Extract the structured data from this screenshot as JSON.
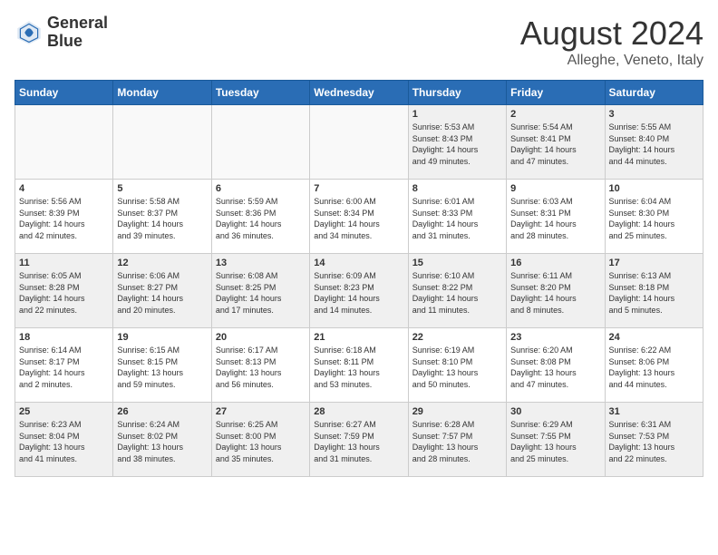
{
  "header": {
    "logo_line1": "General",
    "logo_line2": "Blue",
    "month_year": "August 2024",
    "location": "Alleghe, Veneto, Italy"
  },
  "days_of_week": [
    "Sunday",
    "Monday",
    "Tuesday",
    "Wednesday",
    "Thursday",
    "Friday",
    "Saturday"
  ],
  "weeks": [
    [
      {
        "day": "",
        "info": "",
        "empty": true
      },
      {
        "day": "",
        "info": "",
        "empty": true
      },
      {
        "day": "",
        "info": "",
        "empty": true
      },
      {
        "day": "",
        "info": "",
        "empty": true
      },
      {
        "day": "1",
        "info": "Sunrise: 5:53 AM\nSunset: 8:43 PM\nDaylight: 14 hours\nand 49 minutes.",
        "empty": false
      },
      {
        "day": "2",
        "info": "Sunrise: 5:54 AM\nSunset: 8:41 PM\nDaylight: 14 hours\nand 47 minutes.",
        "empty": false
      },
      {
        "day": "3",
        "info": "Sunrise: 5:55 AM\nSunset: 8:40 PM\nDaylight: 14 hours\nand 44 minutes.",
        "empty": false
      }
    ],
    [
      {
        "day": "4",
        "info": "Sunrise: 5:56 AM\nSunset: 8:39 PM\nDaylight: 14 hours\nand 42 minutes.",
        "empty": false
      },
      {
        "day": "5",
        "info": "Sunrise: 5:58 AM\nSunset: 8:37 PM\nDaylight: 14 hours\nand 39 minutes.",
        "empty": false
      },
      {
        "day": "6",
        "info": "Sunrise: 5:59 AM\nSunset: 8:36 PM\nDaylight: 14 hours\nand 36 minutes.",
        "empty": false
      },
      {
        "day": "7",
        "info": "Sunrise: 6:00 AM\nSunset: 8:34 PM\nDaylight: 14 hours\nand 34 minutes.",
        "empty": false
      },
      {
        "day": "8",
        "info": "Sunrise: 6:01 AM\nSunset: 8:33 PM\nDaylight: 14 hours\nand 31 minutes.",
        "empty": false
      },
      {
        "day": "9",
        "info": "Sunrise: 6:03 AM\nSunset: 8:31 PM\nDaylight: 14 hours\nand 28 minutes.",
        "empty": false
      },
      {
        "day": "10",
        "info": "Sunrise: 6:04 AM\nSunset: 8:30 PM\nDaylight: 14 hours\nand 25 minutes.",
        "empty": false
      }
    ],
    [
      {
        "day": "11",
        "info": "Sunrise: 6:05 AM\nSunset: 8:28 PM\nDaylight: 14 hours\nand 22 minutes.",
        "empty": false
      },
      {
        "day": "12",
        "info": "Sunrise: 6:06 AM\nSunset: 8:27 PM\nDaylight: 14 hours\nand 20 minutes.",
        "empty": false
      },
      {
        "day": "13",
        "info": "Sunrise: 6:08 AM\nSunset: 8:25 PM\nDaylight: 14 hours\nand 17 minutes.",
        "empty": false
      },
      {
        "day": "14",
        "info": "Sunrise: 6:09 AM\nSunset: 8:23 PM\nDaylight: 14 hours\nand 14 minutes.",
        "empty": false
      },
      {
        "day": "15",
        "info": "Sunrise: 6:10 AM\nSunset: 8:22 PM\nDaylight: 14 hours\nand 11 minutes.",
        "empty": false
      },
      {
        "day": "16",
        "info": "Sunrise: 6:11 AM\nSunset: 8:20 PM\nDaylight: 14 hours\nand 8 minutes.",
        "empty": false
      },
      {
        "day": "17",
        "info": "Sunrise: 6:13 AM\nSunset: 8:18 PM\nDaylight: 14 hours\nand 5 minutes.",
        "empty": false
      }
    ],
    [
      {
        "day": "18",
        "info": "Sunrise: 6:14 AM\nSunset: 8:17 PM\nDaylight: 14 hours\nand 2 minutes.",
        "empty": false
      },
      {
        "day": "19",
        "info": "Sunrise: 6:15 AM\nSunset: 8:15 PM\nDaylight: 13 hours\nand 59 minutes.",
        "empty": false
      },
      {
        "day": "20",
        "info": "Sunrise: 6:17 AM\nSunset: 8:13 PM\nDaylight: 13 hours\nand 56 minutes.",
        "empty": false
      },
      {
        "day": "21",
        "info": "Sunrise: 6:18 AM\nSunset: 8:11 PM\nDaylight: 13 hours\nand 53 minutes.",
        "empty": false
      },
      {
        "day": "22",
        "info": "Sunrise: 6:19 AM\nSunset: 8:10 PM\nDaylight: 13 hours\nand 50 minutes.",
        "empty": false
      },
      {
        "day": "23",
        "info": "Sunrise: 6:20 AM\nSunset: 8:08 PM\nDaylight: 13 hours\nand 47 minutes.",
        "empty": false
      },
      {
        "day": "24",
        "info": "Sunrise: 6:22 AM\nSunset: 8:06 PM\nDaylight: 13 hours\nand 44 minutes.",
        "empty": false
      }
    ],
    [
      {
        "day": "25",
        "info": "Sunrise: 6:23 AM\nSunset: 8:04 PM\nDaylight: 13 hours\nand 41 minutes.",
        "empty": false
      },
      {
        "day": "26",
        "info": "Sunrise: 6:24 AM\nSunset: 8:02 PM\nDaylight: 13 hours\nand 38 minutes.",
        "empty": false
      },
      {
        "day": "27",
        "info": "Sunrise: 6:25 AM\nSunset: 8:00 PM\nDaylight: 13 hours\nand 35 minutes.",
        "empty": false
      },
      {
        "day": "28",
        "info": "Sunrise: 6:27 AM\nSunset: 7:59 PM\nDaylight: 13 hours\nand 31 minutes.",
        "empty": false
      },
      {
        "day": "29",
        "info": "Sunrise: 6:28 AM\nSunset: 7:57 PM\nDaylight: 13 hours\nand 28 minutes.",
        "empty": false
      },
      {
        "day": "30",
        "info": "Sunrise: 6:29 AM\nSunset: 7:55 PM\nDaylight: 13 hours\nand 25 minutes.",
        "empty": false
      },
      {
        "day": "31",
        "info": "Sunrise: 6:31 AM\nSunset: 7:53 PM\nDaylight: 13 hours\nand 22 minutes.",
        "empty": false
      }
    ]
  ]
}
